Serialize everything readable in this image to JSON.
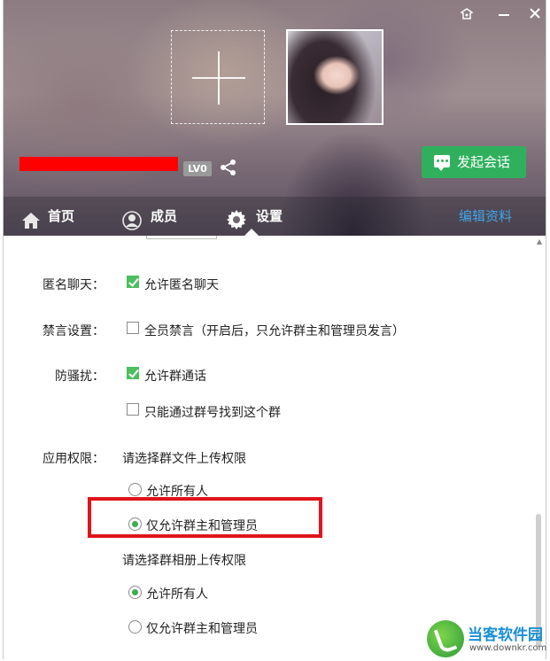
{
  "header": {
    "level_badge": "LV0",
    "start_chat_button": "发起会话"
  },
  "tabs": [
    {
      "label": "首页",
      "icon": "home-icon"
    },
    {
      "label": "成员",
      "icon": "member-icon"
    },
    {
      "label": "设置",
      "icon": "gear-icon",
      "active": true
    }
  ],
  "edit_profile_link": "编辑资料",
  "settings": {
    "anonymous": {
      "label": "匿名聊天：",
      "option": "允许匿名聊天",
      "checked": true
    },
    "mute": {
      "label": "禁言设置：",
      "option": "全员禁言（开启后，只允许群主和管理员发言）",
      "checked": false
    },
    "anti_harass": {
      "label": "防骚扰：",
      "option_call": "允许群通话",
      "option_call_checked": true,
      "option_search": "只能通过群号找到这个群",
      "option_search_checked": false
    },
    "app_permission": {
      "label": "应用权限：",
      "file_title": "请选择群文件上传权限",
      "file_options": [
        "允许所有人",
        "仅允许群主和管理员"
      ],
      "file_selected": 1,
      "album_title": "请选择群相册上传权限",
      "album_options": [
        "允许所有人",
        "仅允许群主和管理员"
      ],
      "album_selected": 0
    }
  },
  "watermark": {
    "title": "当客软件园",
    "url": "www.downkr.com"
  },
  "colors": {
    "accent_green": "#30b05d",
    "link_blue": "#3fa5ea",
    "highlight_red": "#e0141b"
  }
}
